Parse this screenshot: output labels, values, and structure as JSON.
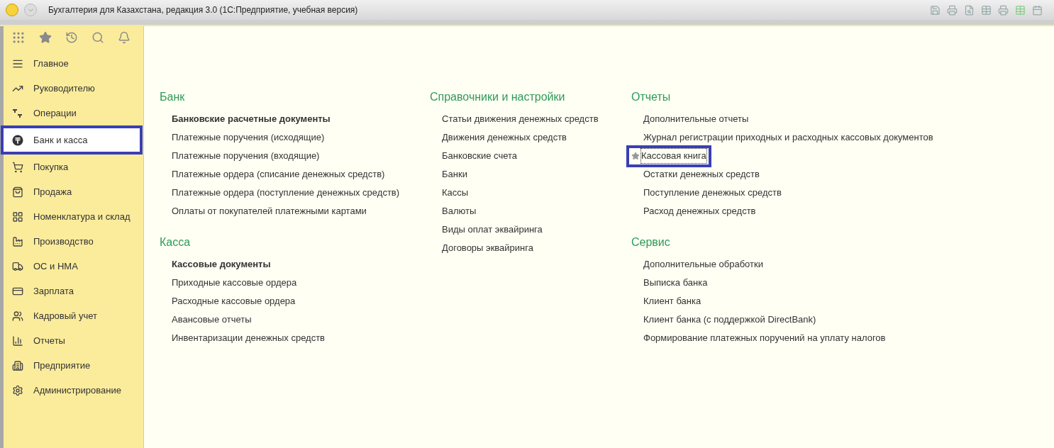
{
  "window": {
    "title": "Бухгалтерия для Казахстана, редакция 3.0  (1С:Предприятие, учебная версия)"
  },
  "sidebar": {
    "items": [
      {
        "label": "Главное",
        "selected": false
      },
      {
        "label": "Руководителю",
        "selected": false
      },
      {
        "label": "Операции",
        "selected": false
      },
      {
        "label": "Банк и касса",
        "selected": true
      },
      {
        "label": "Покупка",
        "selected": false
      },
      {
        "label": "Продажа",
        "selected": false
      },
      {
        "label": "Номенклатура и склад",
        "selected": false
      },
      {
        "label": "Производство",
        "selected": false
      },
      {
        "label": "ОС и НМА",
        "selected": false
      },
      {
        "label": "Зарплата",
        "selected": false
      },
      {
        "label": "Кадровый учет",
        "selected": false
      },
      {
        "label": "Отчеты",
        "selected": false
      },
      {
        "label": "Предприятие",
        "selected": false
      },
      {
        "label": "Администрирование",
        "selected": false
      }
    ]
  },
  "columns": [
    {
      "sections": [
        {
          "title": "Банк",
          "items": [
            {
              "label": "Банковские расчетные документы",
              "bold": true,
              "starred": false,
              "highlighted": false
            },
            {
              "label": "Платежные поручения (исходящие)",
              "bold": false,
              "starred": false,
              "highlighted": false
            },
            {
              "label": "Платежные поручения (входящие)",
              "bold": false,
              "starred": false,
              "highlighted": false
            },
            {
              "label": "Платежные ордера (списание денежных средств)",
              "bold": false,
              "starred": false,
              "highlighted": false
            },
            {
              "label": "Платежные ордера (поступление денежных средств)",
              "bold": false,
              "starred": false,
              "highlighted": false
            },
            {
              "label": "Оплаты от покупателей платежными картами",
              "bold": false,
              "starred": false,
              "highlighted": false
            }
          ]
        },
        {
          "title": "Касса",
          "items": [
            {
              "label": "Кассовые документы",
              "bold": true,
              "starred": false,
              "highlighted": false
            },
            {
              "label": "Приходные кассовые ордера",
              "bold": false,
              "starred": false,
              "highlighted": false
            },
            {
              "label": "Расходные кассовые ордера",
              "bold": false,
              "starred": false,
              "highlighted": false
            },
            {
              "label": "Авансовые отчеты",
              "bold": false,
              "starred": false,
              "highlighted": false
            },
            {
              "label": "Инвентаризации денежных средств",
              "bold": false,
              "starred": false,
              "highlighted": false
            }
          ]
        }
      ]
    },
    {
      "sections": [
        {
          "title": "Справочники и настройки",
          "items": [
            {
              "label": "Статьи движения денежных средств",
              "bold": false,
              "starred": false,
              "highlighted": false
            },
            {
              "label": "Движения денежных средств",
              "bold": false,
              "starred": false,
              "highlighted": false
            },
            {
              "label": "Банковские счета",
              "bold": false,
              "starred": false,
              "highlighted": false
            },
            {
              "label": "Банки",
              "bold": false,
              "starred": false,
              "highlighted": false
            },
            {
              "label": "Кассы",
              "bold": false,
              "starred": false,
              "highlighted": false
            },
            {
              "label": "Валюты",
              "bold": false,
              "starred": false,
              "highlighted": false
            },
            {
              "label": "Виды оплат эквайринга",
              "bold": false,
              "starred": false,
              "highlighted": false
            },
            {
              "label": "Договоры эквайринга",
              "bold": false,
              "starred": false,
              "highlighted": false
            }
          ]
        }
      ]
    },
    {
      "sections": [
        {
          "title": "Отчеты",
          "items": [
            {
              "label": "Дополнительные отчеты",
              "bold": false,
              "starred": false,
              "highlighted": false
            },
            {
              "label": "Журнал регистрации приходных и расходных кассовых документов",
              "bold": false,
              "starred": false,
              "highlighted": false
            },
            {
              "label": "Кассовая книга",
              "bold": false,
              "starred": true,
              "highlighted": true
            },
            {
              "label": "Остатки денежных средств",
              "bold": false,
              "starred": false,
              "highlighted": false
            },
            {
              "label": "Поступление денежных средств",
              "bold": false,
              "starred": false,
              "highlighted": false
            },
            {
              "label": "Расход денежных средств",
              "bold": false,
              "starred": false,
              "highlighted": false
            }
          ]
        },
        {
          "title": "Сервис",
          "items": [
            {
              "label": "Дополнительные обработки",
              "bold": false,
              "starred": false,
              "highlighted": false
            },
            {
              "label": "Выписка банка",
              "bold": false,
              "starred": false,
              "highlighted": false
            },
            {
              "label": "Клиент банка",
              "bold": false,
              "starred": false,
              "highlighted": false
            },
            {
              "label": "Клиент банка (с поддержкой DirectBank)",
              "bold": false,
              "starred": false,
              "highlighted": false
            },
            {
              "label": "Формирование платежных поручений на уплату налогов",
              "bold": false,
              "starred": false,
              "highlighted": false
            }
          ]
        }
      ]
    }
  ]
}
